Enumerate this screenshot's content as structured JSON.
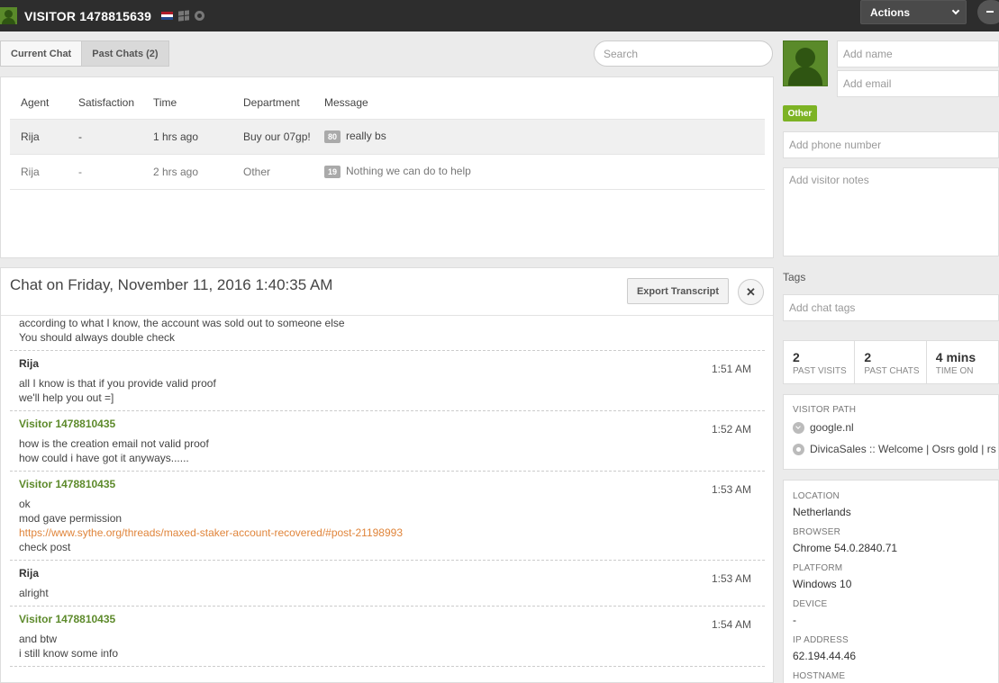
{
  "header": {
    "title": "VISITOR 1478815639",
    "actions_label": "Actions",
    "flag_colors": [
      "#ae1c28",
      "#ffffff",
      "#21468b"
    ]
  },
  "tabs": [
    {
      "label": "Current Chat"
    },
    {
      "label": "Past Chats (2)"
    }
  ],
  "search": {
    "placeholder": "Search"
  },
  "past_chats": {
    "columns": [
      "Agent",
      "Satisfaction",
      "Time",
      "Department",
      "Message"
    ],
    "rows": [
      {
        "agent": "Rija",
        "satisfaction": "-",
        "time": "1 hrs ago",
        "department": "Buy our 07gp!",
        "score": "80",
        "message": "really bs"
      },
      {
        "agent": "Rija",
        "satisfaction": "-",
        "time": "2 hrs ago",
        "department": "Other",
        "score": "19",
        "message": "Nothing we can do to help"
      }
    ]
  },
  "transcript": {
    "title": "Chat on Friday, November 11, 2016 1:40:35 AM",
    "export_label": "Export Transcript",
    "close_glyph": "✕",
    "messages": [
      {
        "sender": "",
        "time": "",
        "lines": [
          "according to what I know, the account was sold out to someone else",
          "You should always double check"
        ]
      },
      {
        "sender": "Rija",
        "type": "agent",
        "time": "1:51 AM",
        "lines": [
          "all I know is that if you provide valid proof",
          "we'll help you out =]"
        ]
      },
      {
        "sender": "Visitor 1478810435",
        "type": "visitor",
        "time": "1:52 AM",
        "lines": [
          "how is the creation email not valid proof",
          "how could i have got it anyways......"
        ]
      },
      {
        "sender": "Visitor 1478810435",
        "type": "visitor",
        "time": "1:53 AM",
        "lines": [
          "ok",
          "mod gave permission",
          "https://www.sythe.org/threads/maxed-staker-account-recovered/#post-21198993",
          "check post"
        ]
      },
      {
        "sender": "Rija",
        "type": "agent",
        "time": "1:53 AM",
        "lines": [
          "alright"
        ]
      },
      {
        "sender": "Visitor 1478810435",
        "type": "visitor",
        "time": "1:54 AM",
        "lines": [
          "and btw",
          "i still know some info"
        ]
      }
    ]
  },
  "visitor": {
    "name_placeholder": "Add name",
    "email_placeholder": "Add email",
    "department_badge": "Other",
    "phone_placeholder": "Add phone number",
    "notes_placeholder": "Add visitor notes",
    "tags_label": "Tags",
    "tags_placeholder": "Add chat tags",
    "stats": [
      {
        "value": "2",
        "label": "PAST VISITS"
      },
      {
        "value": "2",
        "label": "PAST CHATS"
      },
      {
        "value": "4 mins",
        "label": "TIME ON"
      }
    ],
    "path_label": "VISITOR PATH",
    "path": [
      {
        "icon": "referrer-icon",
        "text": "google.nl"
      },
      {
        "icon": "page-icon",
        "text": "DivicaSales :: Welcome | Osrs gold | rs"
      }
    ],
    "info": [
      {
        "label": "LOCATION",
        "value": "Netherlands"
      },
      {
        "label": "BROWSER",
        "value": "Chrome 54.0.2840.71"
      },
      {
        "label": "PLATFORM",
        "value": "Windows 10"
      },
      {
        "label": "DEVICE",
        "value": "-"
      },
      {
        "label": "IP ADDRESS",
        "value": "62.194.44.46"
      },
      {
        "label": "HOSTNAME",
        "value": ""
      }
    ]
  }
}
